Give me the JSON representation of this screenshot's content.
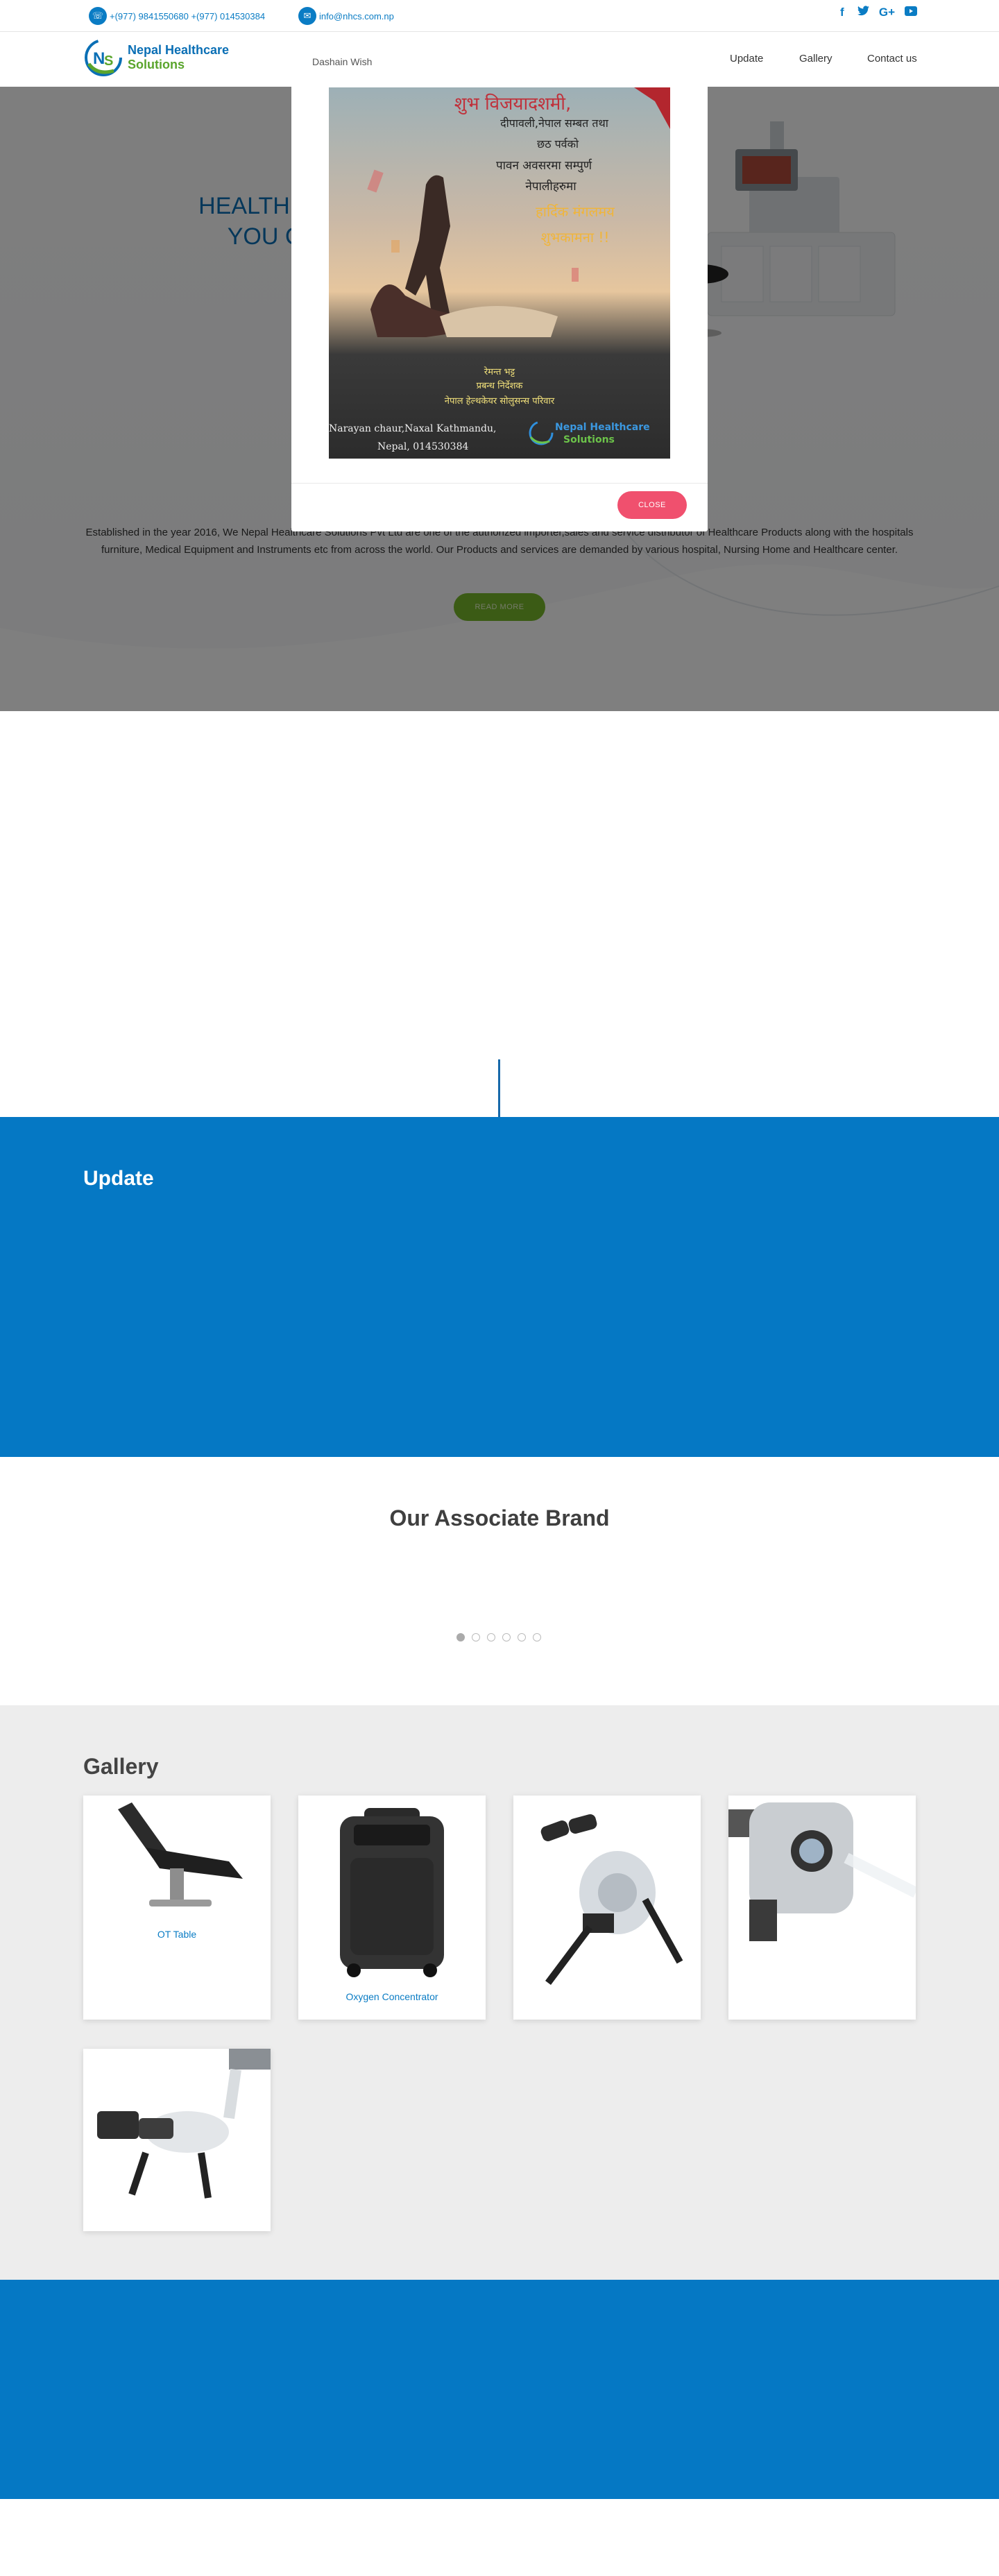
{
  "topbar": {
    "phone_icon": "phone-icon",
    "phone": "+(977) 9841550680 +(977) 014530384",
    "mail_icon": "mail-icon",
    "email": "info@nhcs.com.np",
    "social": [
      "facebook-icon",
      "twitter-icon",
      "google-plus-icon",
      "youtube-icon"
    ]
  },
  "header": {
    "logo_line1": "Nepal Healthcare",
    "logo_line2": "Solutions",
    "nav": [
      "Update",
      "Gallery",
      "Contact us"
    ]
  },
  "hero": {
    "title_line1": "HEALTH CARE S",
    "title_line2": "YOU CAN T",
    "text": "Established in the year 2016, We Nepal Healthcare Solutions Pvt Ltd are one of the authorized importer,sales and service distributor of Healthcare Products along with the hospitals furniture, Medical Equipment and Instruments etc from across the world. Our Products and services are demanded by various hospital, Nursing Home and Healthcare center.",
    "read_more": "READ MORE"
  },
  "modal": {
    "title": "Dashain Wish",
    "close": "CLOSE",
    "poster": {
      "line1": "शुभ विजयादशमी,",
      "line2": "दीपावली,नेपाल सम्बत तथा",
      "line3": "छठ पर्वको",
      "line4": "पावन अवसरमा सम्पुर्ण",
      "line5": "नेपालीहरुमा",
      "line6": "हार्दिक मंगलमय",
      "line7": "शुभकामना !!",
      "sign1": "रेमन्त भट्ट",
      "sign2": "प्रबन्ध निर्देशक",
      "sign3": "नेपाल हेल्थकेयर सोलुसन्स परिवार",
      "addr1": "Narayan chaur,Naxal Kathmandu,",
      "addr2": "Nepal, 014530384",
      "brand1": "Nepal Healthcare",
      "brand2": "Solutions"
    }
  },
  "update": {
    "title": "Update"
  },
  "associate": {
    "title": "Our Associate Brand",
    "dots": 6
  },
  "gallery": {
    "title": "Gallery",
    "items": [
      {
        "label": "OT Table"
      },
      {
        "label": "Oxygen Concentrator"
      },
      {
        "label": ""
      },
      {
        "label": ""
      },
      {
        "label": ""
      }
    ]
  },
  "colors": {
    "brand_blue": "#0578c4",
    "accent_green": "#76b72a",
    "close_red": "#f0506e"
  }
}
